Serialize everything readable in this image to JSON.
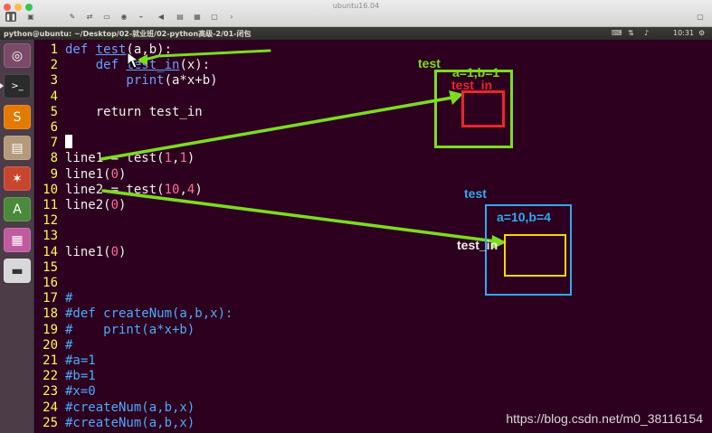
{
  "vm": {
    "title": "ubuntu16.04"
  },
  "panel": {
    "path": "python@ubuntu: ~/Desktop/02-就业班/02-python高级-2/01-闭包",
    "time": "10:31"
  },
  "code_lines": [
    {
      "n": "1",
      "tokens": [
        {
          "t": "def ",
          "c": "kw"
        },
        {
          "t": "test",
          "c": "fn"
        },
        {
          "t": "(a,b):",
          "c": "wh"
        }
      ]
    },
    {
      "n": "2",
      "tokens": [
        {
          "t": "    def ",
          "c": "kw"
        },
        {
          "t": "test_in",
          "c": "fn"
        },
        {
          "t": "(x):",
          "c": "wh"
        }
      ]
    },
    {
      "n": "3",
      "tokens": [
        {
          "t": "        print",
          "c": "kw"
        },
        {
          "t": "(a*x+b)",
          "c": "wh"
        }
      ]
    },
    {
      "n": "4",
      "tokens": []
    },
    {
      "n": "5",
      "tokens": [
        {
          "t": "    return test_in",
          "c": "wh"
        }
      ]
    },
    {
      "n": "6",
      "tokens": []
    },
    {
      "n": "7",
      "tokens": []
    },
    {
      "n": "8",
      "tokens": [
        {
          "t": "line1 = test(",
          "c": "wh"
        },
        {
          "t": "1",
          "c": "num"
        },
        {
          "t": ",",
          "c": "wh"
        },
        {
          "t": "1",
          "c": "num"
        },
        {
          "t": ")",
          "c": "wh"
        }
      ]
    },
    {
      "n": "9",
      "tokens": [
        {
          "t": "line1(",
          "c": "wh"
        },
        {
          "t": "0",
          "c": "num"
        },
        {
          "t": ")",
          "c": "wh"
        }
      ]
    },
    {
      "n": "10",
      "tokens": [
        {
          "t": "line2 = test(",
          "c": "wh"
        },
        {
          "t": "10",
          "c": "num"
        },
        {
          "t": ",",
          "c": "wh"
        },
        {
          "t": "4",
          "c": "num"
        },
        {
          "t": ")",
          "c": "wh"
        }
      ]
    },
    {
      "n": "11",
      "tokens": [
        {
          "t": "line2(",
          "c": "wh"
        },
        {
          "t": "0",
          "c": "num"
        },
        {
          "t": ")",
          "c": "wh"
        }
      ]
    },
    {
      "n": "12",
      "tokens": []
    },
    {
      "n": "13",
      "tokens": []
    },
    {
      "n": "14",
      "tokens": [
        {
          "t": "line1(",
          "c": "wh"
        },
        {
          "t": "0",
          "c": "num"
        },
        {
          "t": ")",
          "c": "wh"
        }
      ]
    },
    {
      "n": "15",
      "tokens": []
    },
    {
      "n": "16",
      "tokens": []
    },
    {
      "n": "17",
      "tokens": [
        {
          "t": "#",
          "c": "cm"
        }
      ]
    },
    {
      "n": "18",
      "tokens": [
        {
          "t": "#def createNum(a,b,x):",
          "c": "cm"
        }
      ]
    },
    {
      "n": "19",
      "tokens": [
        {
          "t": "#    print(a*x+b)",
          "c": "cm"
        }
      ]
    },
    {
      "n": "20",
      "tokens": [
        {
          "t": "#",
          "c": "cm"
        }
      ]
    },
    {
      "n": "21",
      "tokens": [
        {
          "t": "#a=1",
          "c": "cm"
        }
      ]
    },
    {
      "n": "22",
      "tokens": [
        {
          "t": "#b=1",
          "c": "cm"
        }
      ]
    },
    {
      "n": "23",
      "tokens": [
        {
          "t": "#x=0",
          "c": "cm"
        }
      ]
    },
    {
      "n": "24",
      "tokens": [
        {
          "t": "#createNum(a,b,x)",
          "c": "cm"
        }
      ]
    },
    {
      "n": "25",
      "tokens": [
        {
          "t": "#createNum(a,b,x)",
          "c": "cm"
        }
      ]
    }
  ],
  "annotations": {
    "box1_outer_label": "test",
    "box1_params": "a=1,b=1",
    "box1_inner_label": "test_in",
    "box2_outer_label": "test",
    "box2_params": "a=10,b=4",
    "box2_inner_label": "test_in"
  },
  "watermark": "https://blog.csdn.net/m0_38116154",
  "colors": {
    "green": "#7ddc1f",
    "red": "#e8262b",
    "blue": "#33a8ef",
    "yellow": "#f5d800"
  }
}
